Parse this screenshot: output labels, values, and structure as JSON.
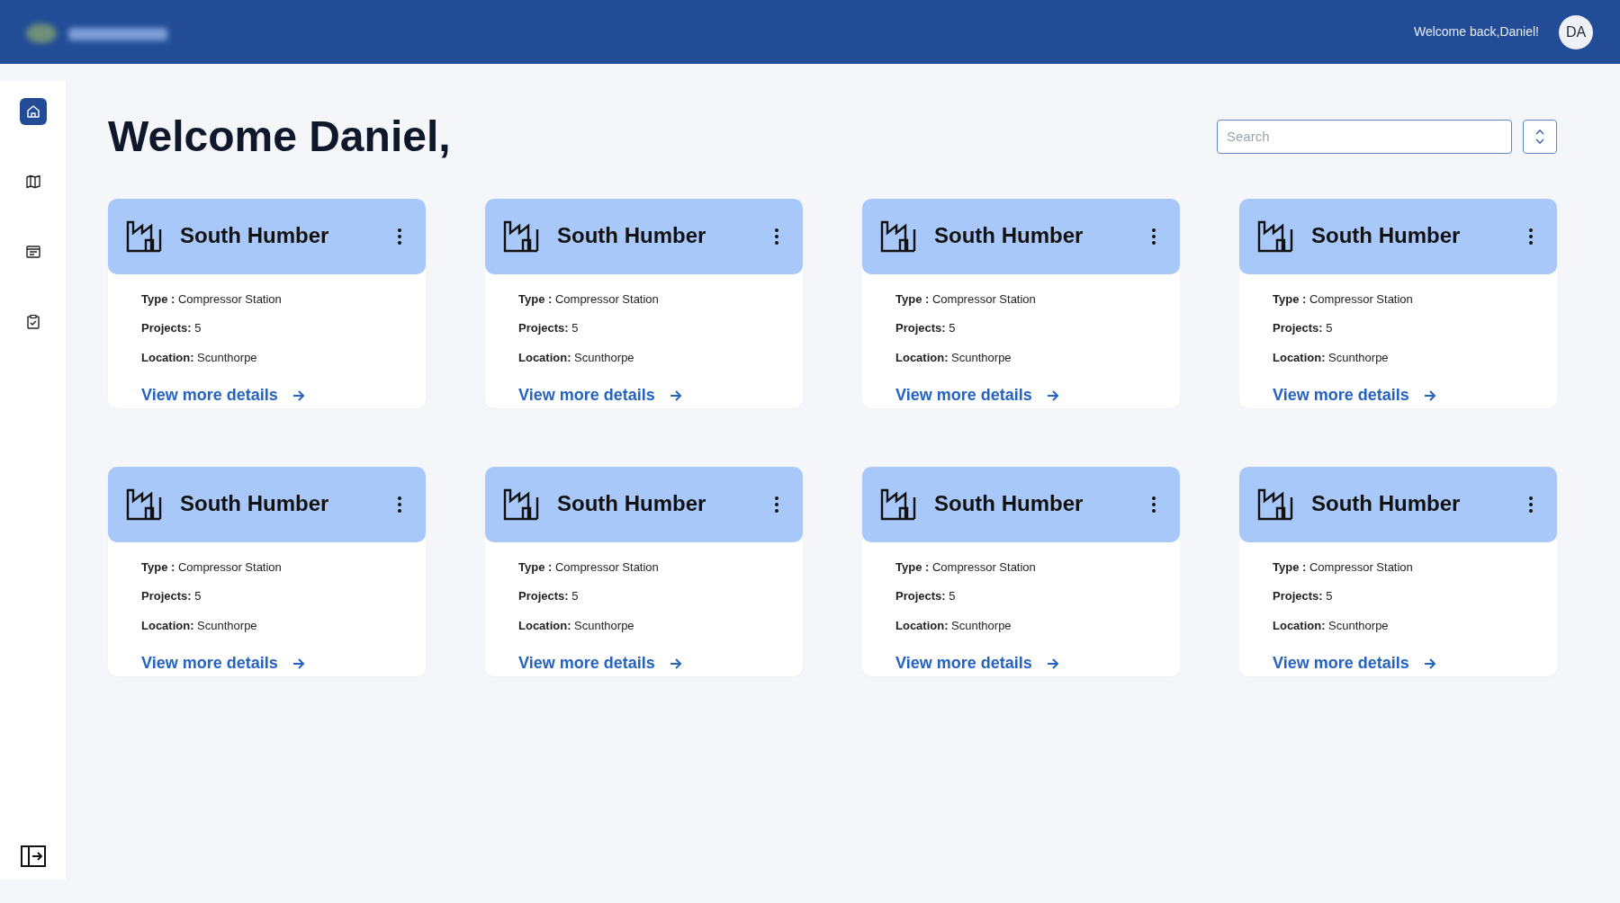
{
  "header": {
    "greeting": "Welcome back,Daniel!",
    "avatar": "DA"
  },
  "sidebar": {
    "items": [
      {
        "kind": "home",
        "selected": true
      },
      {
        "kind": "map",
        "selected": false
      },
      {
        "kind": "list",
        "selected": false
      },
      {
        "kind": "clipboard",
        "selected": false
      }
    ]
  },
  "page": {
    "title": "Welcome Daniel,"
  },
  "search": {
    "placeholder": "Search"
  },
  "cards": [
    {
      "title": "South Humber",
      "lines": [
        "**Type :** Compressor Station",
        "**Projects:** 5",
        "**Location:** Scunthorpe"
      ],
      "link": "View more details"
    },
    {
      "title": "South Humber",
      "lines": [
        "**Type :** Compressor Station",
        "**Projects:** 5",
        "**Location:** Scunthorpe"
      ],
      "link": "View more details"
    },
    {
      "title": "South Humber",
      "lines": [
        "**Type :** Compressor Station",
        "**Projects:** 5",
        "**Location:** Scunthorpe"
      ],
      "link": "View more details"
    },
    {
      "title": "South Humber",
      "lines": [
        "**Type :** Compressor Station",
        "**Projects:** 5",
        "**Location:** Scunthorpe"
      ],
      "link": "View more details"
    },
    {
      "title": "South Humber",
      "lines": [
        "**Type :** Compressor Station",
        "**Projects:** 5",
        "**Location:** Scunthorpe"
      ],
      "link": "View more details"
    },
    {
      "title": "South Humber",
      "lines": [
        "**Type :** Compressor Station",
        "**Projects:** 5",
        "**Location:** Scunthorpe"
      ],
      "link": "View more details"
    },
    {
      "title": "South Humber",
      "lines": [
        "**Type :** Compressor Station",
        "**Projects:** 5",
        "**Location:** Scunthorpe"
      ],
      "link": "View more details"
    },
    {
      "title": "South Humber",
      "lines": [
        "**Type :** Compressor Station",
        "**Projects:** 5",
        "**Location:** Scunthorpe"
      ],
      "link": "View more details"
    }
  ]
}
